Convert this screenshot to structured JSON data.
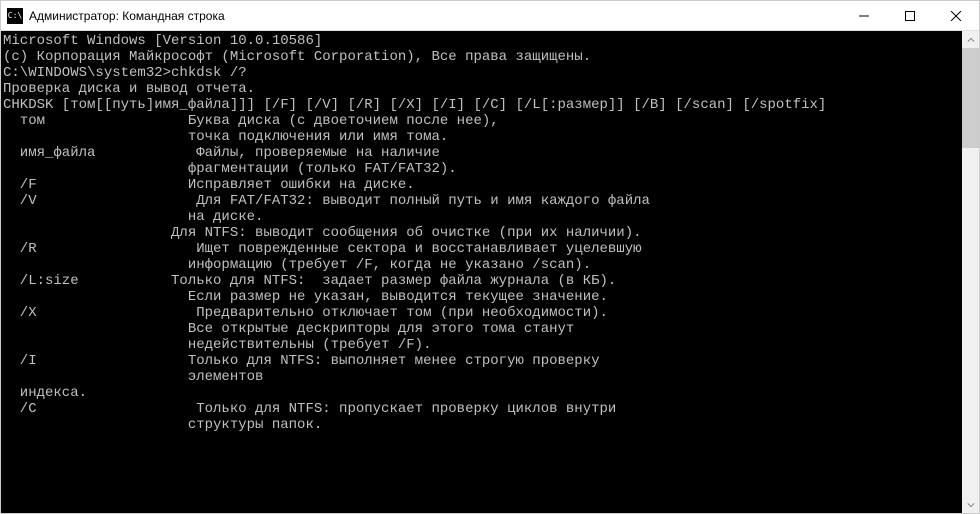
{
  "titlebar": {
    "icon_label": "C:\\",
    "title": "Администратор: Командная строка"
  },
  "terminal": {
    "lines": [
      "Microsoft Windows [Version 10.0.10586]",
      "(с) Корпорация Майкрософт (Microsoft Corporation), Все права защищены.",
      "",
      "C:\\WINDOWS\\system32>chkdsk /?",
      "Проверка диска и вывод отчета.",
      "",
      "",
      "CHKDSK [том[[путь]имя_файла]]] [/F] [/V] [/R] [/X] [/I] [/C] [/L[:размер]] [/B] [/scan] [/spotfix]",
      "",
      "",
      "  том                 Буква диска (с двоеточием после нее),",
      "                      точка подключения или имя тома.",
      "  имя_файла            Файлы, проверяемые на наличие",
      "                      фрагментации (только FAT/FAT32).",
      "  /F                  Исправляет ошибки на диске.",
      "  /V                   Для FAT/FAT32: выводит полный путь и имя каждого файла",
      "                      на диске.",
      "                    Для NTFS: выводит сообщения об очистке (при их наличии).",
      "  /R                   Ищет поврежденные сектора и восстанавливает уцелевшую",
      "                      информацию (требует /F, когда не указано /scan).",
      "  /L:size           Только для NTFS:  задает размер файла журнала (в КБ).",
      "                      Если размер не указан, выводится текущее значение.",
      "  /X                   Предварительно отключает том (при необходимости).",
      "                      Все открытые дескрипторы для этого тома станут",
      "                      недействительны (требует /F).",
      "  /I                  Только для NTFS: выполняет менее строгую проверку",
      "                      элементов",
      "  индекса.",
      "  /C                   Только для NTFS: пропускает проверку циклов внутри",
      "                      структуры папок."
    ]
  }
}
